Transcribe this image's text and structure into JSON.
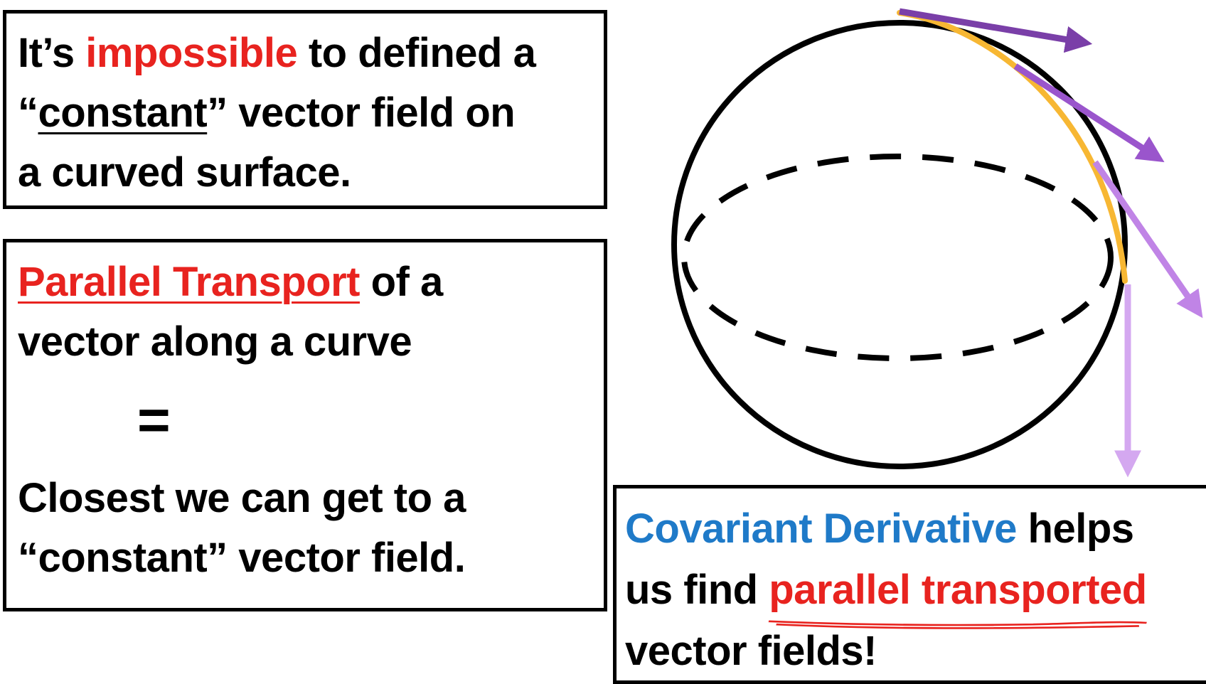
{
  "box1": {
    "line1_part1": "It’s ",
    "line1_highlight": "impossible",
    "line1_part2": " to defined a",
    "line2_open_quote": "“",
    "line2_underlined": "constant",
    "line2_rest": "” vector field on",
    "line3": "a curved surface."
  },
  "box2": {
    "line1_highlight": "Parallel Transport",
    "line1_rest": " of a",
    "line2": "vector along a curve",
    "equals": "=",
    "line3": "Closest we can get to a",
    "line4": "“constant” vector field."
  },
  "box3": {
    "line1_highlight": "Covariant Derivative",
    "line1_rest": " helps",
    "line2_part1": "us find ",
    "line2_highlight": "parallel transported",
    "line3": "vector fields!"
  },
  "colors": {
    "emphasis_red": "#e8231f",
    "emphasis_blue": "#1f7ac8",
    "curve_orange": "#f7b733",
    "arrow_dark_purple": "#7a3fa8",
    "arrow_purple": "#9a55cc",
    "arrow_light_purple": "#c084e6",
    "arrow_pale_purple": "#d4a8f0"
  }
}
